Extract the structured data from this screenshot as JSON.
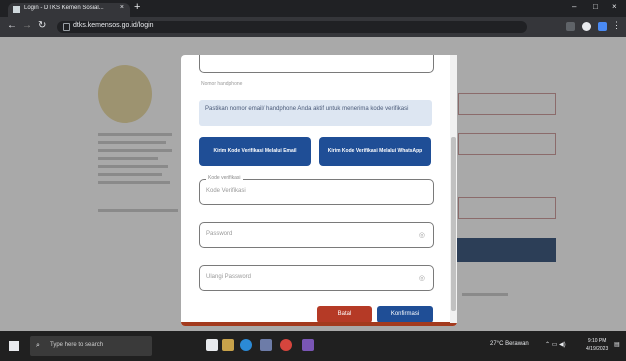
{
  "browser": {
    "tab_title": "Login - DTKS Kemen Sosial...",
    "tab_close": "×",
    "new_tab": "+",
    "url": "dtks.kemensos.go.id/login",
    "window_controls": [
      "–",
      "□",
      "×"
    ],
    "icons": [
      "back-icon",
      "forward-icon",
      "reload-icon",
      "lock-icon",
      "extensions-icon",
      "profile-icon",
      "menu-icon"
    ]
  },
  "modal": {
    "hint": "Nomor handphone",
    "info_text": "Pastikan nomor email/ handphone Anda aktif untuk menerima kode verifikasi",
    "btn_email": "Kirim Kode Verifikasi Melalui Email",
    "btn_whatsapp": "Kirim Kode Verifikasi Melalui WhatsApp",
    "field_code_label": "Kode verifikasi",
    "field_code_placeholder": "Kode Verifikasi",
    "field_password_placeholder": "Password",
    "field_confirm_placeholder": "Ulangi Password",
    "btn_cancel": "Batal",
    "btn_confirm": "Konfirmasi"
  },
  "taskbar": {
    "search_placeholder": "Type here to search",
    "weather": "27°C Berawan",
    "time": "9:10 PM",
    "date": "4/19/2023"
  },
  "colors": {
    "primary_blue": "#1f4e96",
    "cancel_red": "#b53a26",
    "info_bg": "#dde6f2"
  }
}
